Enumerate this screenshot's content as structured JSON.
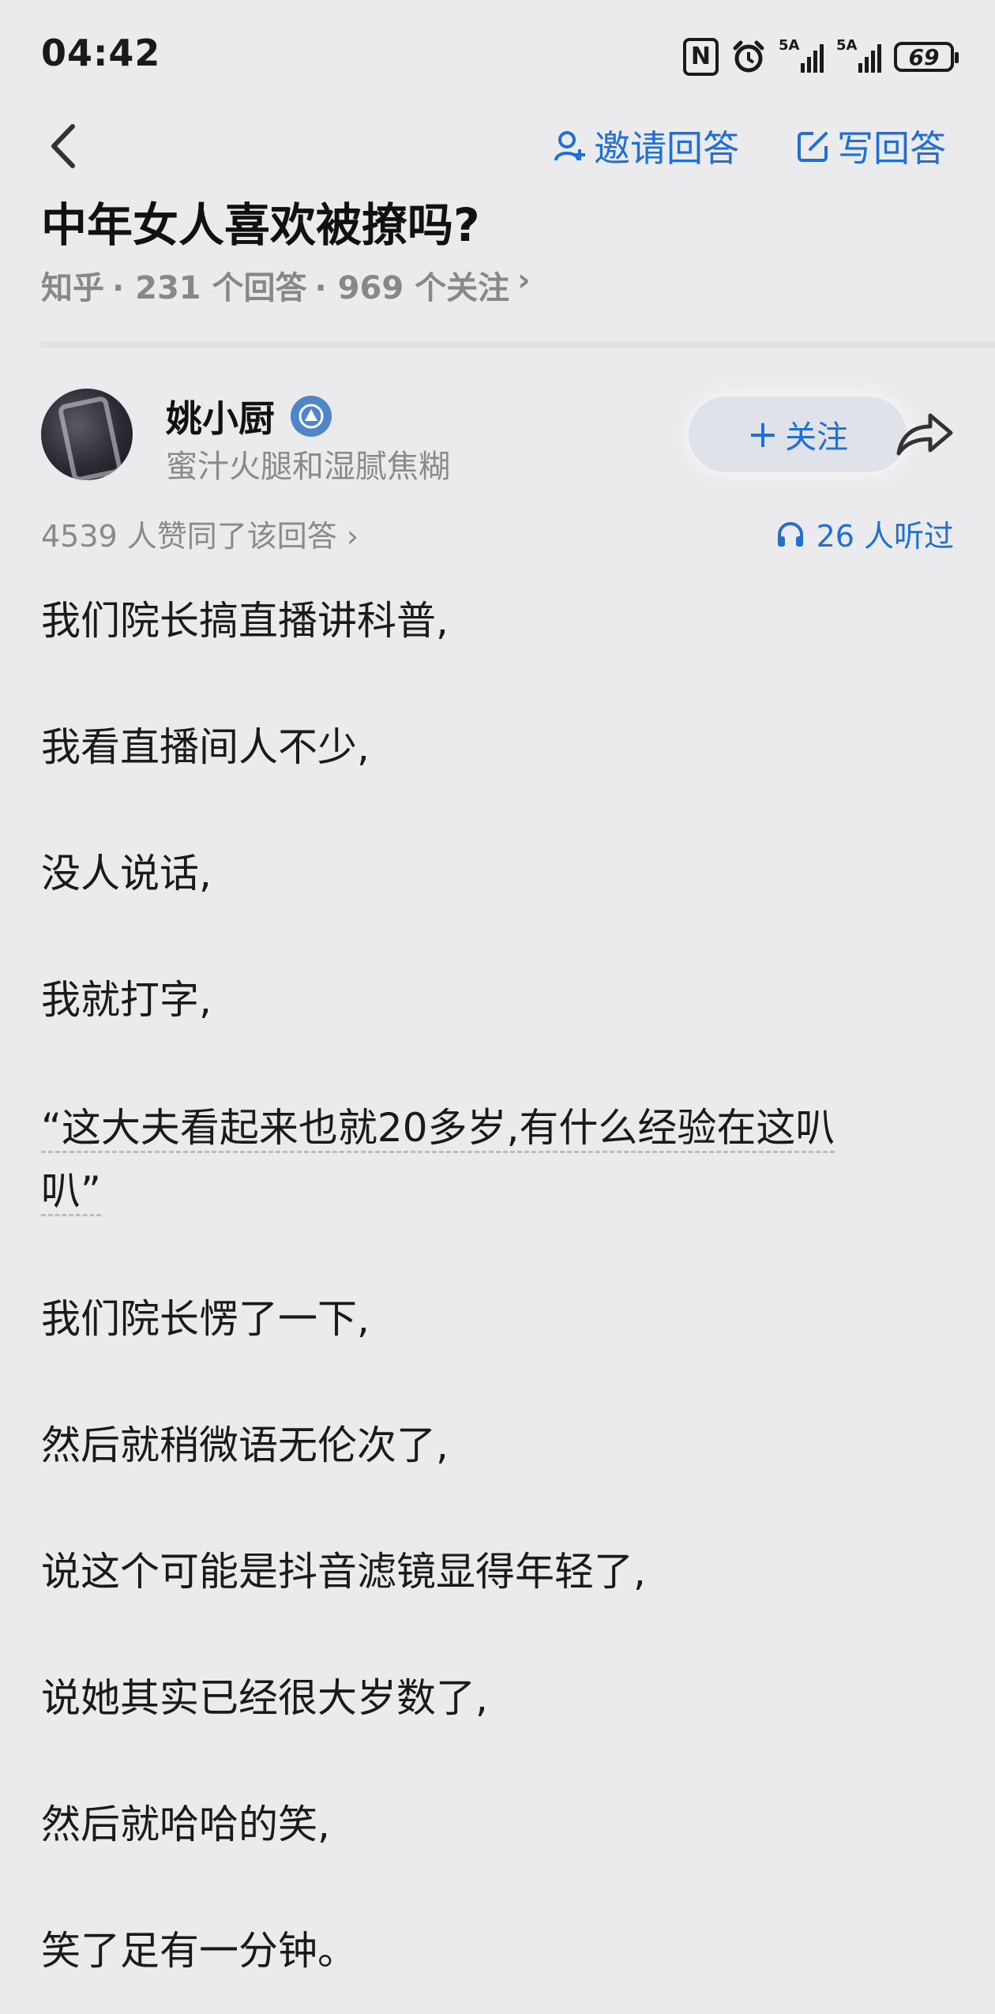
{
  "status_bar": {
    "time": "04:42",
    "nfc_icon_text": "N",
    "network_label_1": "5A",
    "network_label_2": "5A",
    "battery": "69"
  },
  "nav": {
    "invite_label": "邀请回答",
    "write_label": "写回答"
  },
  "question": {
    "title": "中年女人喜欢被撩吗?",
    "source": "知乎",
    "answers": "· 231 个回答",
    "followers": "· 969 个关注",
    "chevron": "›"
  },
  "author": {
    "name": "姚小厨",
    "bio": "蜜汁火腿和湿腻焦糊",
    "follow_label": "关注",
    "follow_plus": "+"
  },
  "stats": {
    "likes": "4539 人赞同了该回答 ›",
    "listened": "26 人听过"
  },
  "content": {
    "paragraphs": [
      "我们院长搞直播讲科普,",
      "我看直播间人不少,",
      "没人说话,",
      "我就打字,",
      "“这大夫看起来也就20多岁,有什么经验在这叭",
      "叭”",
      "我们院长愣了一下,",
      "然后就稍微语无伦次了,",
      "说这个可能是抖音滤镜显得年轻了,",
      "说她其实已经很大岁数了,",
      "然后就哈哈的笑,",
      "笑了足有一分钟。"
    ]
  },
  "colors": {
    "background": "#ebebed",
    "accent_blue": "#1f6fd6",
    "muted_gray": "#8a8a8a"
  }
}
